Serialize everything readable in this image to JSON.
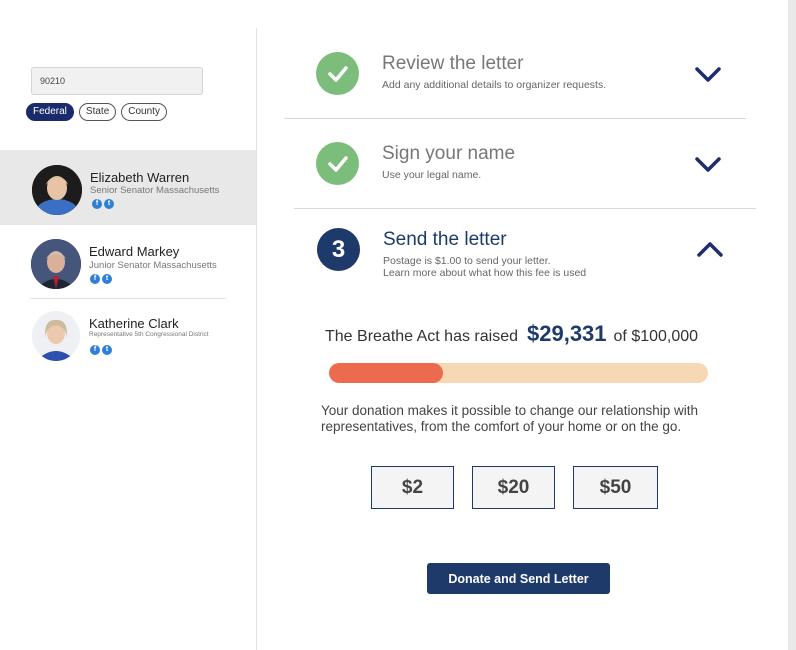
{
  "sidebar": {
    "zip_value": "90210",
    "filters": [
      "Federal",
      "State",
      "County"
    ],
    "active_filter": "Federal",
    "representatives": [
      {
        "name": "Elizabeth Warren",
        "title": "Senior Senator Massachusetts",
        "selected": true
      },
      {
        "name": "Edward Markey",
        "title": "Junior Senator Massachusetts",
        "selected": false
      },
      {
        "name": "Katherine Clark",
        "title": "Representative 5th Congressional District",
        "selected": false
      }
    ],
    "social_icons": [
      "facebook-icon",
      "twitter-icon"
    ]
  },
  "steps": [
    {
      "title": "Review the letter",
      "subtitle": "Add any additional details to organizer requests.",
      "status": "done",
      "expanded": false
    },
    {
      "title": "Sign your name",
      "subtitle": "Use your legal name.",
      "status": "done",
      "expanded": false
    },
    {
      "number": "3",
      "title": "Send the letter",
      "subtitle_line1": "Postage is $1.00 to send your letter.",
      "subtitle_line2": "Learn more about what how this fee is used",
      "status": "active",
      "expanded": true
    }
  ],
  "fundraiser": {
    "prefix": "The Breathe Act has raised",
    "raised": "$29,331",
    "goal_text": "of $100,000",
    "progress_fraction": 0.3,
    "description": "Your donation makes it possible to change our relationship with representatives, from the comfort of your home or on the go.",
    "amounts": [
      "$2",
      "$20",
      "$50"
    ],
    "button_label": "Donate and Send Letter"
  },
  "colors": {
    "navy": "#1e3a6b",
    "check_green": "#7dbd7b",
    "progress_fill": "#ec6a4e",
    "progress_track": "#f6d8b4"
  }
}
